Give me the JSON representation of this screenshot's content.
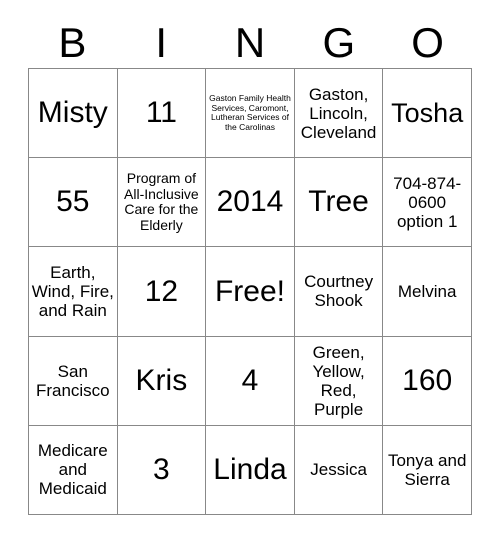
{
  "header": {
    "letters": [
      "B",
      "I",
      "N",
      "G",
      "O"
    ]
  },
  "grid": {
    "rows": [
      [
        {
          "text": "Misty",
          "size": "sz-xl"
        },
        {
          "text": "11",
          "size": "sz-xl"
        },
        {
          "text": "Gaston Family Health Services, Caromont, Lutheran Services of the Carolinas",
          "size": "sz-xs"
        },
        {
          "text": "Gaston, Lincoln, Cleveland",
          "size": "sz-md"
        },
        {
          "text": "Tosha",
          "size": "sz-lg"
        }
      ],
      [
        {
          "text": "55",
          "size": "sz-xl"
        },
        {
          "text": "Program of All-Inclusive Care for the Elderly",
          "size": "sz-sm"
        },
        {
          "text": "2014",
          "size": "sz-xl"
        },
        {
          "text": "Tree",
          "size": "sz-xl"
        },
        {
          "text": "704-874-0600 option 1",
          "size": "sz-md"
        }
      ],
      [
        {
          "text": "Earth, Wind, Fire, and Rain",
          "size": "sz-md"
        },
        {
          "text": "12",
          "size": "sz-xl"
        },
        {
          "text": "Free!",
          "size": "sz-xl"
        },
        {
          "text": "Courtney Shook",
          "size": "sz-md"
        },
        {
          "text": "Melvina",
          "size": "sz-md"
        }
      ],
      [
        {
          "text": "San Francisco",
          "size": "sz-md"
        },
        {
          "text": "Kris",
          "size": "sz-xl"
        },
        {
          "text": "4",
          "size": "sz-xl"
        },
        {
          "text": "Green, Yellow, Red, Purple",
          "size": "sz-md"
        },
        {
          "text": "160",
          "size": "sz-xl"
        }
      ],
      [
        {
          "text": "Medicare and Medicaid",
          "size": "sz-md"
        },
        {
          "text": "3",
          "size": "sz-xl"
        },
        {
          "text": "Linda",
          "size": "sz-xl"
        },
        {
          "text": "Jessica",
          "size": "sz-md"
        },
        {
          "text": "Tonya and Sierra",
          "size": "sz-md"
        }
      ]
    ]
  },
  "colors": {
    "grid_line": "#888888",
    "text": "#000000",
    "background": "#ffffff"
  }
}
